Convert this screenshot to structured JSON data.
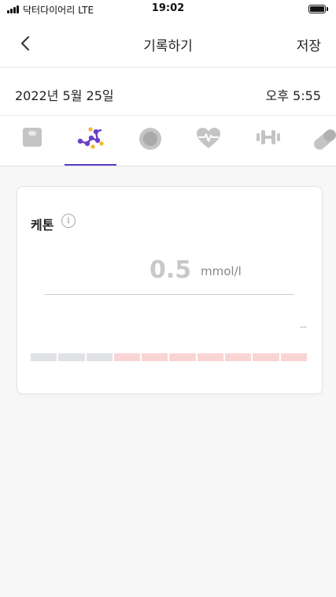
{
  "status_bar": {
    "carrier": "닥터다이어리",
    "network": "LTE",
    "time": "19:02"
  },
  "nav": {
    "title": "기록하기",
    "save_label": "저장",
    "back_icon": "chevron-left-icon"
  },
  "record": {
    "date": "2022년 5월 25일",
    "time": "오후 5:55"
  },
  "tabs": [
    {
      "icon": "scale-icon",
      "selected": false
    },
    {
      "icon": "ketone-molecule-icon",
      "selected": true
    },
    {
      "icon": "circle-target-icon",
      "selected": false
    },
    {
      "icon": "heart-pulse-icon",
      "selected": false
    },
    {
      "icon": "dumbbell-icon",
      "selected": false
    },
    {
      "icon": "pill-icon",
      "selected": false
    }
  ],
  "ketone_card": {
    "title": "케톤",
    "info_icon": "info-icon",
    "value": "0.5",
    "unit": "mmol/l",
    "status_text": "--",
    "scale_segments": [
      "gray",
      "gray",
      "gray",
      "pink",
      "pink",
      "pink",
      "pink",
      "pink",
      "pink",
      "pink"
    ]
  },
  "colors": {
    "accent": "#5b3cc4",
    "molecule_purple": "#6a3fc8",
    "molecule_yellow": "#f5b62b",
    "icon_gray": "#c4c4c4",
    "segment_gray": "#e1e2e6",
    "segment_pink": "#f9d4d4"
  }
}
